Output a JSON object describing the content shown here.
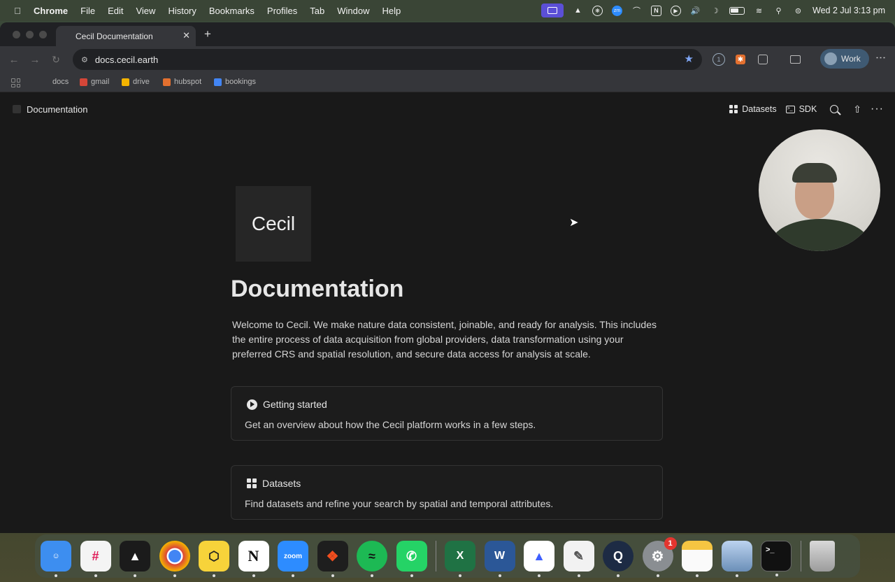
{
  "menubar": {
    "app": "Chrome",
    "items": [
      "File",
      "Edit",
      "View",
      "History",
      "Bookmarks",
      "Profiles",
      "Tab",
      "Window",
      "Help"
    ],
    "status_icons": [
      "screen-recording-icon",
      "figma-agent-icon",
      "gear-icon",
      "zoom-icon",
      "arc-icon",
      "notion-icon",
      "play-icon",
      "volume-icon",
      "moon-icon",
      "battery-icon",
      "wifi-icon",
      "search-icon",
      "control-center-icon"
    ],
    "datetime": "Wed 2 Jul  3:13 pm"
  },
  "browser": {
    "tab_title": "Cecil Documentation",
    "url": "docs.cecil.earth",
    "profile_label": "Work",
    "bookmarks": [
      "docs",
      "gmail",
      "drive",
      "hubspot",
      "bookings"
    ],
    "accent": "#7fa6f5"
  },
  "page": {
    "header_title": "Documentation",
    "header_links": [
      "Datasets",
      "SDK"
    ],
    "logo_text": "Cecil",
    "heading": "Documentation",
    "intro": "Welcome to Cecil. We make nature data consistent, joinable, and ready for analysis. This includes the entire process of data acquisition from global providers, data transformation using your preferred CRS and spatial resolution, and secure data access for analysis at scale.",
    "cards": [
      {
        "title": "Getting started",
        "description": "Get an overview about how the Cecil platform works in a few steps.",
        "icon": "play-circle-icon"
      },
      {
        "title": "Datasets",
        "description": "Find datasets and refine your search by spatial and temporal attributes.",
        "icon": "grid-icon"
      }
    ]
  },
  "dock": {
    "apps": [
      "finder",
      "slack",
      "cursor",
      "chrome",
      "bee",
      "notion",
      "zoom",
      "figma",
      "spotify",
      "whatsapp",
      "excel",
      "word",
      "nordvpn",
      "textedit",
      "quicktime",
      "system-settings",
      "notes",
      "preview",
      "terminal",
      "trash"
    ],
    "settings_badge": "1"
  }
}
